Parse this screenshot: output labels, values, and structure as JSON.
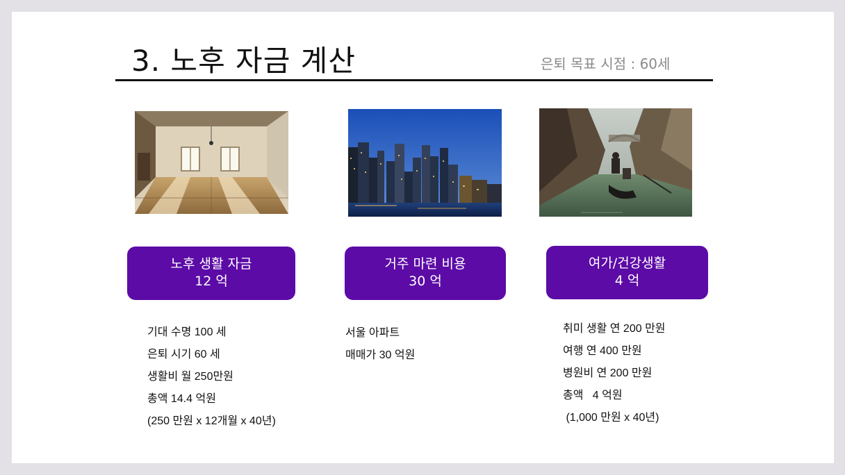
{
  "slide": {
    "title": "3. 노후 자금 계산",
    "subtitle": "은퇴 목표 시점 : 60세"
  },
  "columns": [
    {
      "image": "empty-room-photo",
      "badge_line1": "노후 생활 자금",
      "badge_line2": "12 억",
      "details": [
        "기대 수명 100 세",
        "은퇴 시기 60 세",
        "생활비 월 250만원",
        "총액 14.4 억원",
        "(250 만원 x 12개월 x 40년)"
      ]
    },
    {
      "image": "city-skyline-photo",
      "badge_line1": "거주 마련 비용",
      "badge_line2": "30 억",
      "details": [
        "서울 아파트",
        "매매가 30 억원"
      ]
    },
    {
      "image": "venice-gondola-photo",
      "badge_line1": "여가/건강생활",
      "badge_line2": "4 억",
      "details": [
        "취미 생활 연 200 만원",
        "여행 연 400 만원",
        "병원비 연 200 만원",
        "총액   4 억원",
        " (1,000 만원 x 40년)"
      ]
    }
  ],
  "colors": {
    "badge": "#5c0ba6",
    "background": "#e3e1e6",
    "slide": "#ffffff"
  }
}
